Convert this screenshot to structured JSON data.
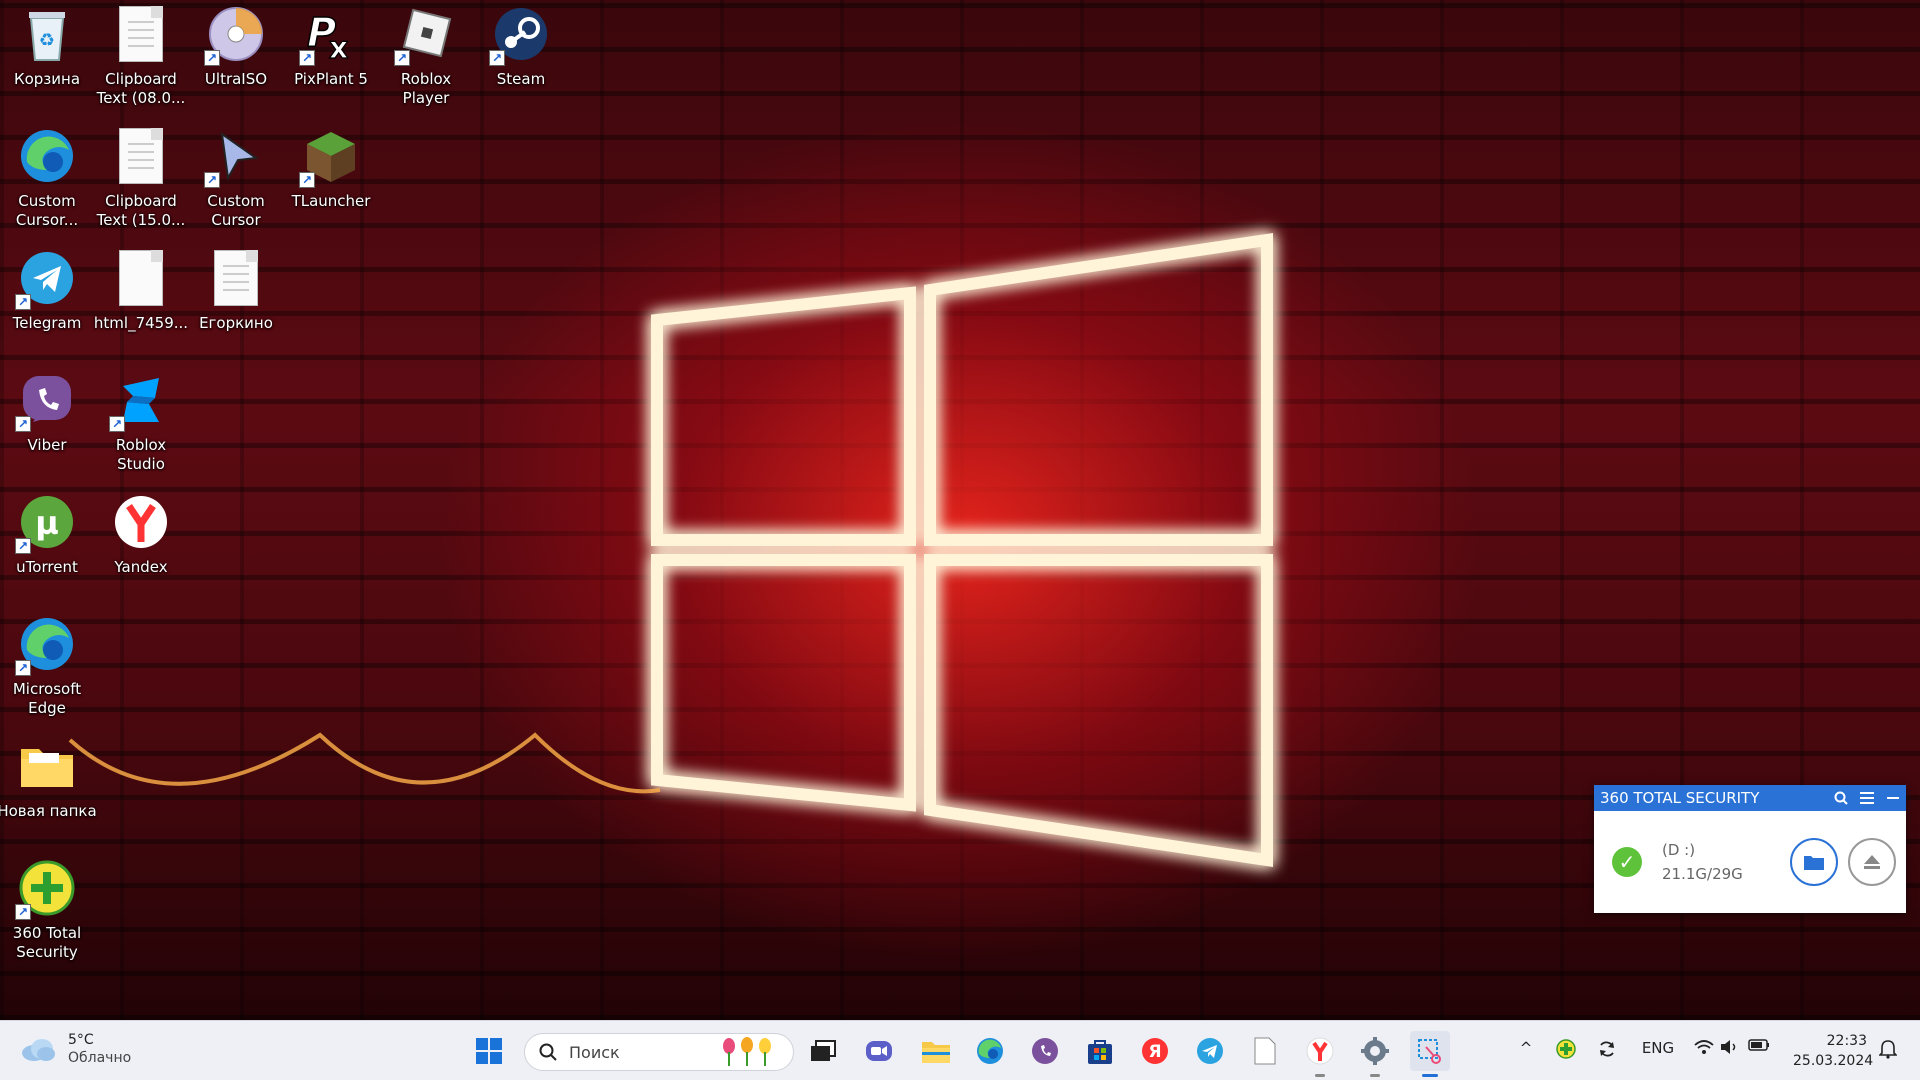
{
  "desktop": {
    "icons": [
      {
        "label": "Корзина",
        "icon": "recycle-bin-icon"
      },
      {
        "label": "Clipboard\nText (08.0...",
        "icon": "text-file-icon"
      },
      {
        "label": "UltraISO",
        "icon": "ultraiso-icon"
      },
      {
        "label": "PixPlant 5",
        "icon": "pixplant-icon"
      },
      {
        "label": "Roblox Player",
        "icon": "roblox-icon"
      },
      {
        "label": "Steam",
        "icon": "steam-icon"
      },
      {
        "label": "Custom\nCursor...",
        "icon": "edge-icon"
      },
      {
        "label": "Clipboard\nText (15.0...",
        "icon": "text-file-icon"
      },
      {
        "label": "Custom\nCursor",
        "icon": "cursor-icon"
      },
      {
        "label": "TLauncher",
        "icon": "grass-block-icon"
      },
      {
        "label": "Telegram",
        "icon": "telegram-icon"
      },
      {
        "label": "html_7459...",
        "icon": "blank-file-icon"
      },
      {
        "label": "Егоркино",
        "icon": "text-file-icon"
      },
      {
        "label": "Viber",
        "icon": "viber-icon"
      },
      {
        "label": "Roblox\nStudio",
        "icon": "roblox-studio-icon"
      },
      {
        "label": "uTorrent",
        "icon": "utorrent-icon"
      },
      {
        "label": "Yandex",
        "icon": "yandex-icon"
      },
      {
        "label": "Microsoft\nEdge",
        "icon": "edge-icon"
      },
      {
        "label": "Новая папка",
        "icon": "folder-icon"
      },
      {
        "label": "360 Total\nSecurity",
        "icon": "360-security-icon"
      }
    ]
  },
  "widget": {
    "title": "360 TOTAL SECURITY",
    "drive": "(D :)",
    "usage": "21.1G/29G"
  },
  "taskbar": {
    "weather": {
      "temp": "5°C",
      "condition": "Облачно"
    },
    "search_placeholder": "Поиск",
    "lang": "ENG",
    "time": "22:33",
    "date": "25.03.2024"
  },
  "colors": {
    "accent": "#2a72d6",
    "wallpaper_red": "#d81e1e",
    "taskbar_bg": "#eef0f6"
  }
}
